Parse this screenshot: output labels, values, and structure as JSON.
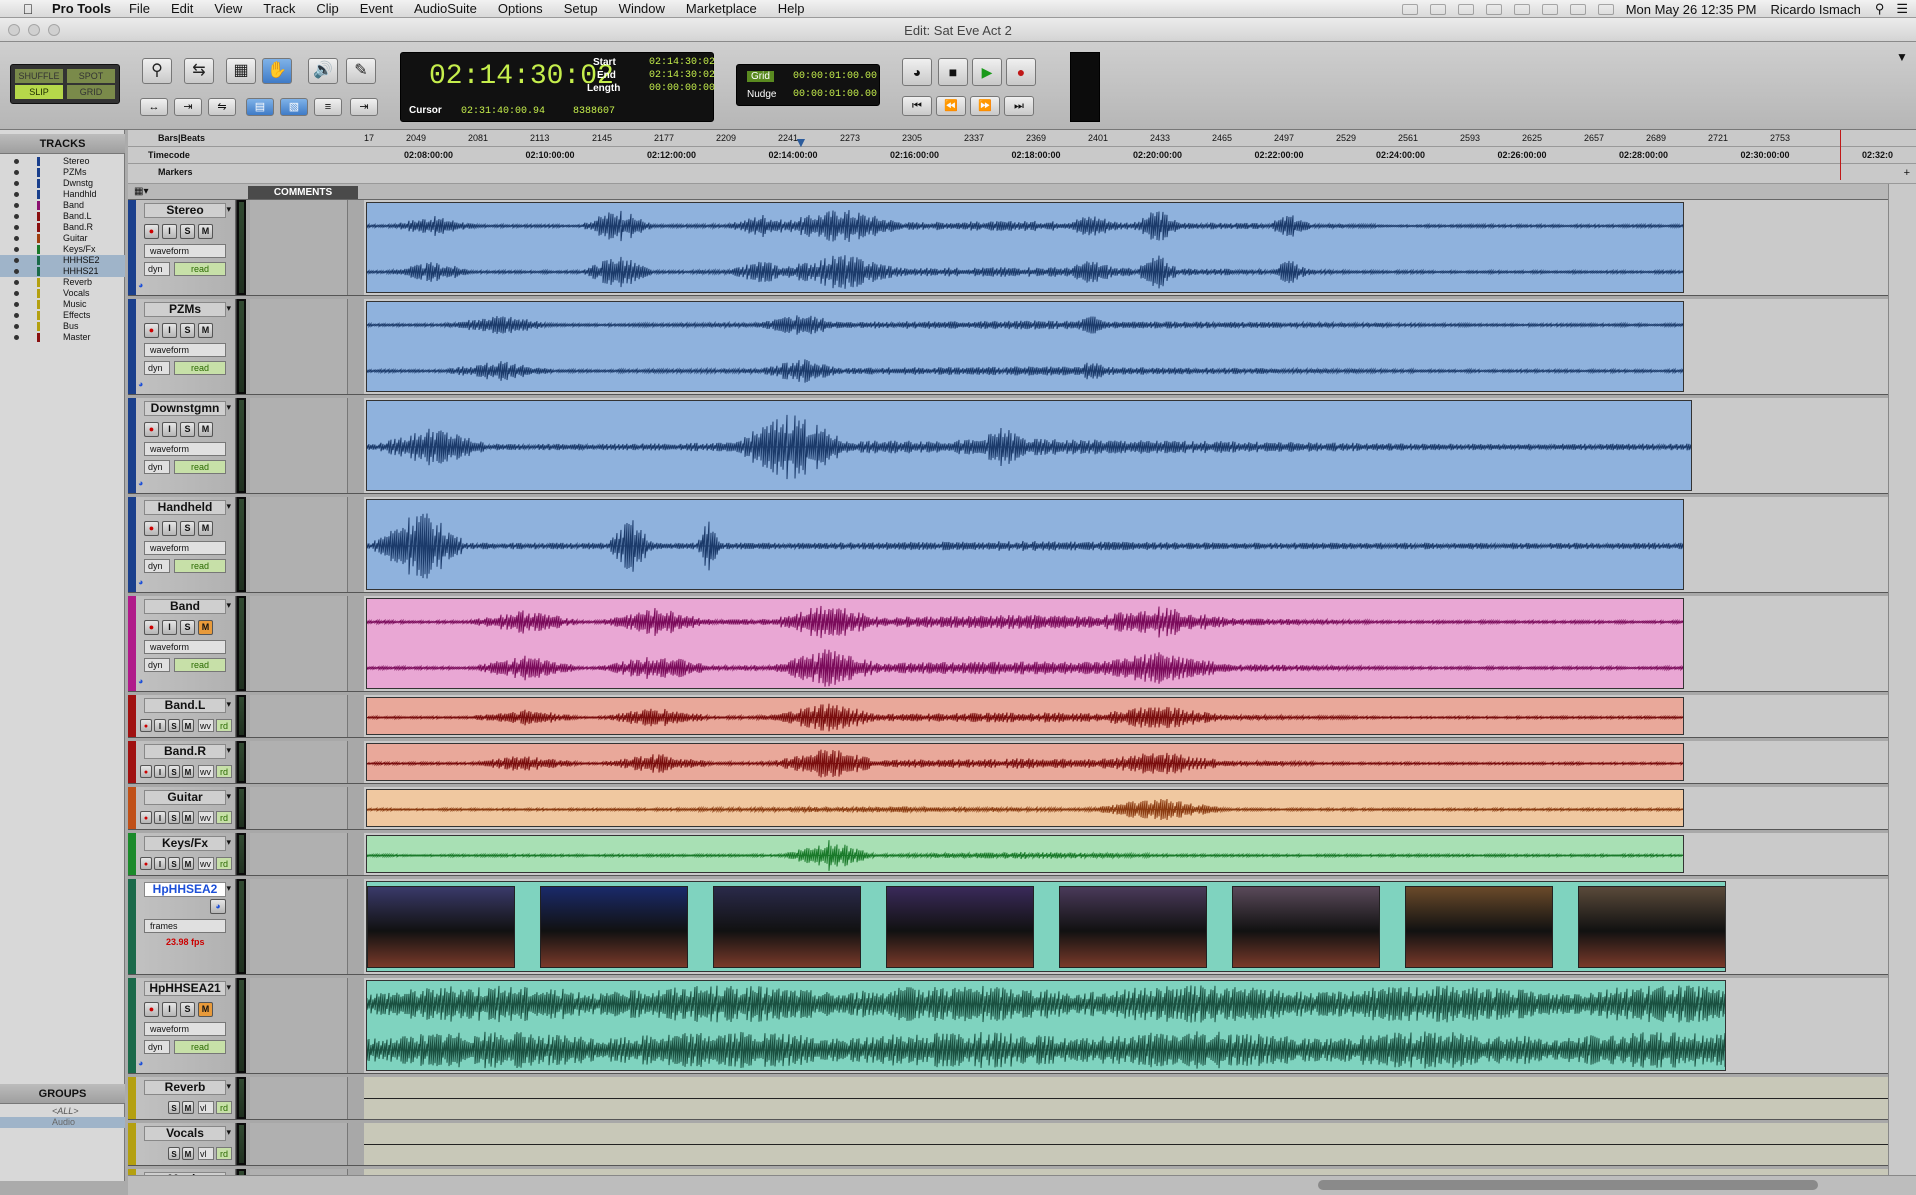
{
  "menubar": {
    "app": "Pro Tools",
    "items": [
      "File",
      "Edit",
      "View",
      "Track",
      "Clip",
      "Event",
      "AudioSuite",
      "Options",
      "Setup",
      "Window",
      "Marketplace",
      "Help"
    ],
    "clock": "Mon May 26  12:35 PM",
    "user": "Ricardo Ismach"
  },
  "window": {
    "title": "Edit: Sat Eve Act 2"
  },
  "toolbar": {
    "modes": {
      "shuffle": "SHUFFLE",
      "spot": "SPOT",
      "slip": "SLIP",
      "grid": "GRID"
    },
    "counter": {
      "main": "02:14:30:02",
      "start_label": "Start",
      "start": "02:14:30:02",
      "end_label": "End",
      "end": "02:14:30:02",
      "length_label": "Length",
      "length": "00:00:00:00",
      "cursor_label": "Cursor",
      "cursor": "02:31:40:00.94",
      "samples": "8388607"
    },
    "grid": {
      "grid_label": "Grid",
      "grid_value": "00:00:01:00.00",
      "nudge_label": "Nudge",
      "nudge_value": "00:00:01:00.00"
    }
  },
  "left_panel": {
    "tracks_title": "TRACKS",
    "groups_title": "GROUPS",
    "track_list": [
      {
        "name": "Stereo",
        "color": "#1a3f8c"
      },
      {
        "name": "PZMs",
        "color": "#1a3f8c"
      },
      {
        "name": "Dwnstg",
        "color": "#1a3f8c"
      },
      {
        "name": "Handhld",
        "color": "#1a3f8c"
      },
      {
        "name": "Band",
        "color": "#8a1070"
      },
      {
        "name": "Band.L",
        "color": "#8a1010"
      },
      {
        "name": "Band.R",
        "color": "#8a1010"
      },
      {
        "name": "Guitar",
        "color": "#a04010"
      },
      {
        "name": "Keys/Fx",
        "color": "#1a7a2a"
      },
      {
        "name": "HHHSE2",
        "color": "#1a6a4a"
      },
      {
        "name": "HHHS21",
        "color": "#1a6a4a"
      },
      {
        "name": "Reverb",
        "color": "#b4a010"
      },
      {
        "name": "Vocals",
        "color": "#b4a010"
      },
      {
        "name": "Music",
        "color": "#b4a010"
      },
      {
        "name": "Effects",
        "color": "#b4a010"
      },
      {
        "name": "Bus",
        "color": "#b4a010"
      },
      {
        "name": "Master",
        "color": "#8a1010"
      }
    ],
    "groups": [
      "<ALL>",
      "Audio"
    ]
  },
  "rulers": {
    "bars_label": "Bars|Beats",
    "timecode_label": "Timecode",
    "markers_label": "Markers",
    "bars_ticks": [
      "17",
      "2049",
      "2081",
      "2113",
      "2145",
      "2177",
      "2209",
      "2241",
      "2273",
      "2305",
      "2337",
      "2369",
      "2401",
      "2433",
      "2465",
      "2497",
      "2529",
      "2561",
      "2593",
      "2625",
      "2657",
      "2689",
      "2721",
      "2753"
    ],
    "tc_ticks": [
      "02:08:00:00",
      "02:10:00:00",
      "02:12:00:00",
      "02:14:00:00",
      "02:16:00:00",
      "02:18:00:00",
      "02:20:00:00",
      "02:22:00:00",
      "02:24:00:00",
      "02:26:00:00",
      "02:28:00:00",
      "02:30:00:00",
      "02:32:0"
    ]
  },
  "column_header": {
    "comments": "COMMENTS"
  },
  "tracks": [
    {
      "name": "Stereo",
      "view": "waveform",
      "auto": "read",
      "dyn": "dyn",
      "color": "#1a3f8c",
      "clip_color": "#8fb2dd",
      "wave_color": "#1b3a6a",
      "type": "audio2",
      "mute": false
    },
    {
      "name": "PZMs",
      "view": "waveform",
      "auto": "read",
      "dyn": "dyn",
      "color": "#1a3f8c",
      "clip_color": "#8fb2dd",
      "wave_color": "#1b3a6a",
      "type": "audio2",
      "mute": false
    },
    {
      "name": "Downstgmn",
      "view": "waveform",
      "auto": "read",
      "dyn": "dyn",
      "color": "#1a3f8c",
      "clip_color": "#8fb2dd",
      "wave_color": "#1b3a6a",
      "type": "audio1",
      "mute": false
    },
    {
      "name": "Handheld",
      "view": "waveform",
      "auto": "read",
      "dyn": "dyn",
      "color": "#1a3f8c",
      "clip_color": "#8fb2dd",
      "wave_color": "#1b3a6a",
      "type": "audio1",
      "mute": false
    },
    {
      "name": "Band",
      "view": "waveform",
      "auto": "read",
      "dyn": "dyn",
      "color": "#b01a8a",
      "clip_color": "#e9a7d4",
      "wave_color": "#7a0a5a",
      "type": "audio2",
      "mute": true
    },
    {
      "name": "Band.L",
      "view": "wv",
      "auto": "rd",
      "color": "#a01010",
      "clip_color": "#e9a89a",
      "wave_color": "#7a0e0e",
      "type": "small",
      "mute": false
    },
    {
      "name": "Band.R",
      "view": "wv",
      "auto": "rd",
      "color": "#a01010",
      "clip_color": "#e9a89a",
      "wave_color": "#7a0e0e",
      "type": "small",
      "mute": false
    },
    {
      "name": "Guitar",
      "view": "wv",
      "auto": "rd",
      "color": "#c05018",
      "clip_color": "#f0c8a0",
      "wave_color": "#8a3a10",
      "type": "small",
      "mute": false
    },
    {
      "name": "Keys/Fx",
      "view": "wv",
      "auto": "rd",
      "color": "#1a8a2a",
      "clip_color": "#a8e0b4",
      "wave_color": "#1a7a2a",
      "type": "small",
      "mute": false
    },
    {
      "name": "HpHHSEA2",
      "view": "frames",
      "fps": "23.98 fps",
      "color": "#1a6a4a",
      "clip_color": "#7fd3bf",
      "type": "video"
    },
    {
      "name": "HpHHSEA21",
      "view": "waveform",
      "auto": "read",
      "dyn": "dyn",
      "color": "#1a6a4a",
      "clip_color": "#7fd3bf",
      "wave_color": "#1a5040",
      "type": "audio2",
      "mute": true
    },
    {
      "name": "Reverb",
      "view": "vl",
      "auto": "rd",
      "color": "#b4a010",
      "type": "aux"
    },
    {
      "name": "Vocals",
      "view": "vl",
      "auto": "rd",
      "color": "#b4a010",
      "type": "aux"
    },
    {
      "name": "Music",
      "view": "vl",
      "auto": "rd",
      "color": "#b4a010",
      "type": "aux"
    }
  ],
  "buttons": {
    "rec": "●",
    "input": "I",
    "solo": "S",
    "mute": "M"
  },
  "colors": {
    "accent": "#3f7bc7",
    "counter_green": "#c5ee4c",
    "cursor_red": "#c01818"
  }
}
